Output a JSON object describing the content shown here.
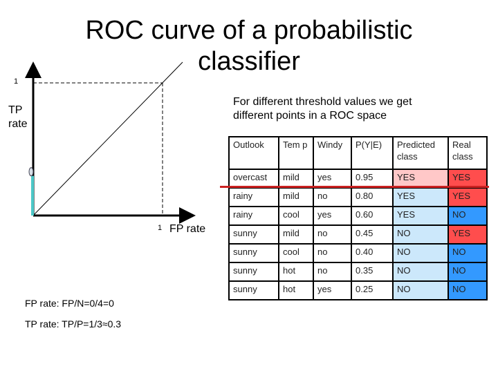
{
  "title": "ROC curve of a probabilistic classifier",
  "subtitle_line1": "For different threshold values we get",
  "subtitle_line2": "different points in a ROC space",
  "diagram": {
    "y_axis_label_line1": "TP",
    "y_axis_label_line2": "rate",
    "x_axis_label": "FP rate",
    "y_tick_1": "1",
    "x_tick_1": "1",
    "current_point": {
      "fp_rate": 0,
      "tp_rate": 0.33
    },
    "segment_color": "#4cc8c8"
  },
  "table": {
    "headers": [
      "Outlook",
      "Tem p",
      "Windy",
      "P(Y|E)",
      "Predicted class",
      "Real class"
    ],
    "rows": [
      {
        "outlook": "overcast",
        "temp": "mild",
        "windy": "yes",
        "p": "0.95",
        "predicted": "YES",
        "real": "YES"
      },
      {
        "outlook": "rainy",
        "temp": "mild",
        "windy": "no",
        "p": "0.80",
        "predicted": "YES",
        "real": "YES"
      },
      {
        "outlook": "rainy",
        "temp": "cool",
        "windy": "yes",
        "p": "0.60",
        "predicted": "YES",
        "real": "NO"
      },
      {
        "outlook": "sunny",
        "temp": "mild",
        "windy": "no",
        "p": "0.45",
        "predicted": "NO",
        "real": "YES"
      },
      {
        "outlook": "sunny",
        "temp": "cool",
        "windy": "no",
        "p": "0.40",
        "predicted": "NO",
        "real": "NO"
      },
      {
        "outlook": "sunny",
        "temp": "hot",
        "windy": "no",
        "p": "0.35",
        "predicted": "NO",
        "real": "NO"
      },
      {
        "outlook": "sunny",
        "temp": "hot",
        "windy": "yes",
        "p": "0.25",
        "predicted": "NO",
        "real": "NO"
      }
    ],
    "threshold_after_row": 1,
    "colors": {
      "predicted_above": "#ffc8c8",
      "predicted_below": "#cce8fb",
      "real_yes": "#ff4d4d",
      "real_no": "#3399ff",
      "threshold_line": "#cc2222"
    }
  },
  "calc": {
    "fp_line": "FP rate: FP/N=0/4=0",
    "tp_line": "TP rate: TP/P=1/3≈0.3"
  }
}
